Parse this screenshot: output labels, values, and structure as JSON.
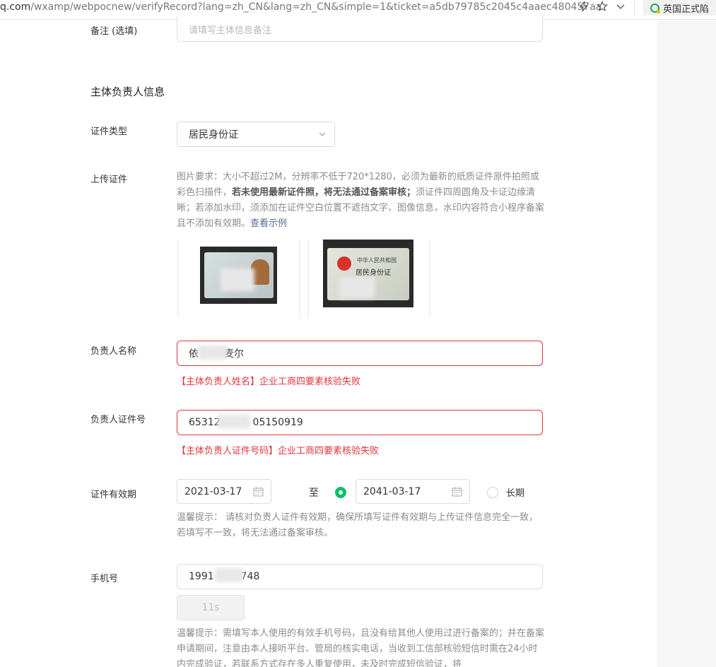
{
  "browser": {
    "url_host": "q.com",
    "url_rest": "/wxamp/webpocnew/verifyRecord?lang=zh_CN&lang=zh_CN&simple=1&ticket=a5db79785c2045c4aaec480457aa",
    "bookmark": "英国正式陷"
  },
  "remark": {
    "label": "备注 (选填)",
    "placeholder": "请填写主体信息备注"
  },
  "section_title": "主体负责人信息",
  "id_type": {
    "label": "证件类型",
    "value": "居民身份证"
  },
  "upload": {
    "label": "上传证件",
    "help_1": "图片要求：大小不超过2M，分辨率不低于720*1280，必须为最新的纸质证件原件拍照或彩色扫描件，",
    "help_bold": "若未使用最新证件照，将无法通过备案审核；",
    "help_2": "须证件四周圆角及卡证边缘清晰；若添加水印，须添加在证件空白位置不遮挡文字、图像信息，水印内容符合小程序备案且不添加有效期。",
    "help_link": "查看示例",
    "back_title": "中华人民共和国",
    "back_subtitle": "居民身份证"
  },
  "name": {
    "label": "负责人名称",
    "value_start": "依",
    "value_end": "麦尔",
    "error": "【主体负责人姓名】企业工商四要素核验失败"
  },
  "id_number": {
    "label": "负责人证件号",
    "value_start": "65312",
    "value_end": "05150919",
    "error": "【主体负责人证件号码】企业工商四要素核验失败"
  },
  "validity": {
    "label": "证件有效期",
    "start": "2021-03-17",
    "to": "至",
    "end": "2041-03-17",
    "long_term": "长期",
    "end_selected": true,
    "tip": "温馨提示： 请核对负责人证件有效期，确保所填写证件有效期与上传证件信息完全一致，若填写不一致，将无法通过备案审核。"
  },
  "phone": {
    "label": "手机号",
    "value_start": "1991",
    "value_end": "748",
    "code_button": "11s",
    "tip": "温馨提示：需填写本人使用的有效手机号码，且没有给其他人使用过进行备案的；并在备案申请期间，注意由本人接听平台、管局的核实电话，当收到工信部核验短信时需在24小时内完成验证，若联系方式存在多人重复使用，未及时完成短信验证，将"
  }
}
